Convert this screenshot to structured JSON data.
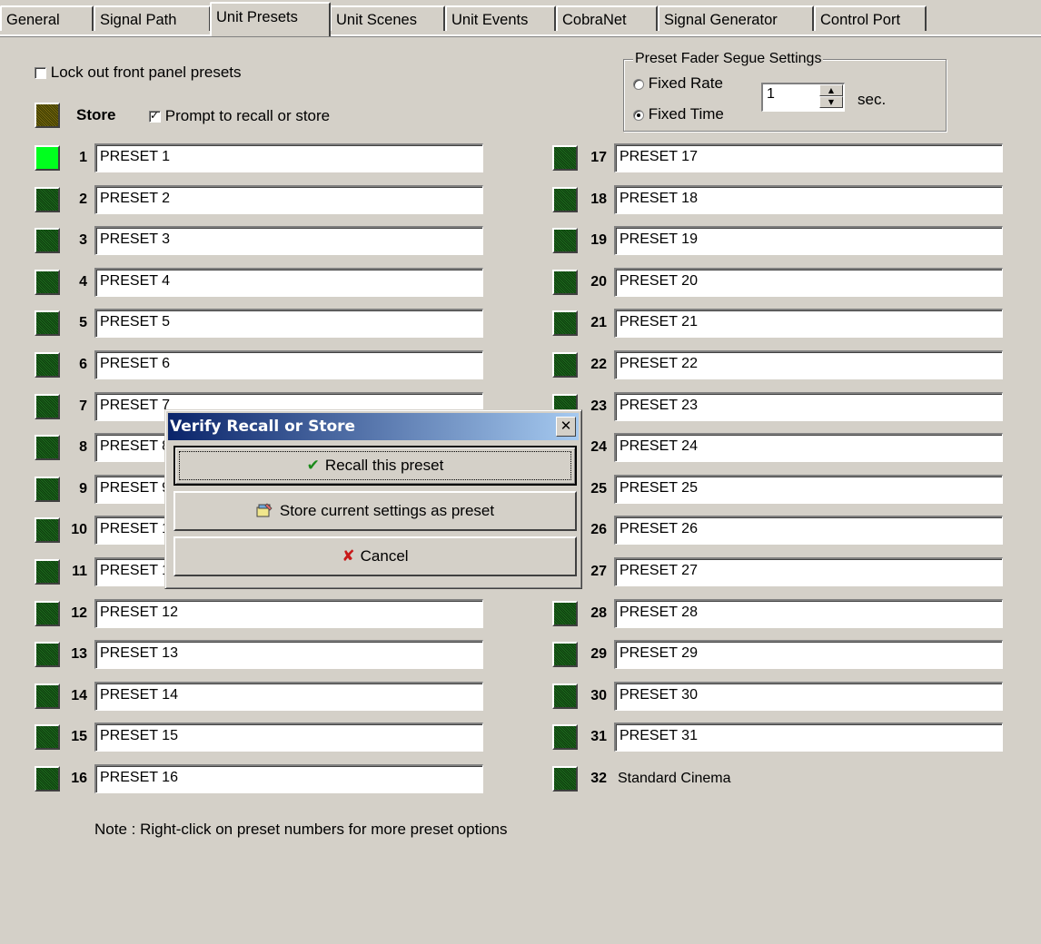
{
  "tabs": [
    {
      "label": "General"
    },
    {
      "label": "Signal Path"
    },
    {
      "label": "Unit Presets",
      "active": true
    },
    {
      "label": "Unit Scenes"
    },
    {
      "label": "Unit Events"
    },
    {
      "label": "CobraNet"
    },
    {
      "label": "Signal Generator"
    },
    {
      "label": "Control Port"
    }
  ],
  "lockout": {
    "label": "Lock out front panel presets",
    "checked": false
  },
  "store": {
    "label": "Store",
    "prompt_label": "Prompt to recall or store",
    "prompt_checked": true
  },
  "segue": {
    "title": "Preset Fader Segue Settings",
    "fixed_rate": "Fixed Rate",
    "fixed_time": "Fixed Time",
    "selected": "fixed_time",
    "value": "1",
    "unit": "sec."
  },
  "presets_left": [
    {
      "num": "1",
      "name": "PRESET 1",
      "active": true
    },
    {
      "num": "2",
      "name": "PRESET 2"
    },
    {
      "num": "3",
      "name": "PRESET 3"
    },
    {
      "num": "4",
      "name": "PRESET 4"
    },
    {
      "num": "5",
      "name": "PRESET 5"
    },
    {
      "num": "6",
      "name": "PRESET 6"
    },
    {
      "num": "7",
      "name": "PRESET 7"
    },
    {
      "num": "8",
      "name": "PRESET 8"
    },
    {
      "num": "9",
      "name": "PRESET 9"
    },
    {
      "num": "10",
      "name": "PRESET 10"
    },
    {
      "num": "11",
      "name": "PRESET 11"
    },
    {
      "num": "12",
      "name": "PRESET 12"
    },
    {
      "num": "13",
      "name": "PRESET 13"
    },
    {
      "num": "14",
      "name": "PRESET 14"
    },
    {
      "num": "15",
      "name": "PRESET 15"
    },
    {
      "num": "16",
      "name": "PRESET 16"
    }
  ],
  "presets_right": [
    {
      "num": "17",
      "name": "PRESET 17"
    },
    {
      "num": "18",
      "name": "PRESET 18"
    },
    {
      "num": "19",
      "name": "PRESET 19"
    },
    {
      "num": "20",
      "name": "PRESET 20"
    },
    {
      "num": "21",
      "name": "PRESET 21"
    },
    {
      "num": "22",
      "name": "PRESET 22"
    },
    {
      "num": "23",
      "name": "PRESET 23"
    },
    {
      "num": "24",
      "name": "PRESET 24"
    },
    {
      "num": "25",
      "name": "PRESET 25"
    },
    {
      "num": "26",
      "name": "PRESET 26"
    },
    {
      "num": "27",
      "name": "PRESET 27"
    },
    {
      "num": "28",
      "name": "PRESET 28"
    },
    {
      "num": "29",
      "name": "PRESET 29"
    },
    {
      "num": "30",
      "name": "PRESET 30"
    },
    {
      "num": "31",
      "name": "PRESET 31"
    },
    {
      "num": "32",
      "name": "Standard Cinema",
      "readonly": true
    }
  ],
  "note": "Note : Right-click on preset numbers for more preset options",
  "dialog": {
    "title": "Verify Recall or Store",
    "close_glyph": "✕",
    "recall_label": "Recall this preset",
    "store_label": "Store current settings as preset",
    "cancel_label": "Cancel"
  },
  "icons": {
    "recall": "check-icon",
    "store": "store-icon",
    "cancel": "x-icon"
  },
  "colors": {
    "active_led": "#00ff1e",
    "inactive_led": "#1e6b1e",
    "titlebar_start": "#0a246a",
    "titlebar_end": "#a6caf0"
  }
}
